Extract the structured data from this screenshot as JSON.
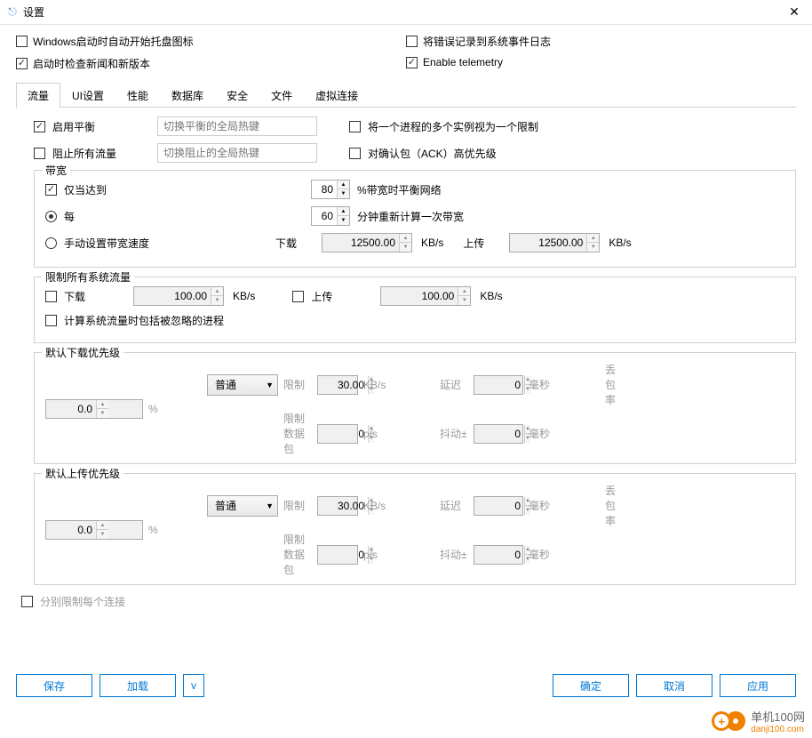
{
  "window": {
    "title": "设置"
  },
  "topOptions": {
    "left": [
      {
        "label": "Windows启动时自动开始托盘图标",
        "checked": false
      },
      {
        "label": "启动时检查新闻和新版本",
        "checked": true
      }
    ],
    "right": [
      {
        "label": "将错误记录到系统事件日志",
        "checked": false
      },
      {
        "label": "Enable telemetry",
        "checked": true
      }
    ]
  },
  "tabs": [
    "流量",
    "UI设置",
    "性能",
    "数据库",
    "安全",
    "文件",
    "虚拟连接"
  ],
  "activeTab": "流量",
  "traffic": {
    "enableBalance": {
      "label": "启用平衡",
      "checked": true,
      "hotkeyPlaceholder": "切换平衡的全局热键"
    },
    "blockAll": {
      "label": "阻止所有流量",
      "checked": false,
      "hotkeyPlaceholder": "切换阻止的全局热键"
    },
    "multiInstance": {
      "label": "将一个进程的多个实例视为一个限制",
      "checked": false
    },
    "ackPriority": {
      "label": "对确认包（ACK）高优先级",
      "checked": false
    }
  },
  "bandwidth": {
    "legend": "带宽",
    "onlyWhen": {
      "label": "仅当达到",
      "checked": true,
      "value": "80",
      "suffix": "%带宽时平衡网络"
    },
    "every": {
      "label": "每",
      "selected": true,
      "value": "60",
      "suffix": "分钟重新计算一次带宽"
    },
    "manual": {
      "label": "手动设置带宽速度",
      "selected": false
    },
    "download": {
      "label": "下载",
      "value": "12500.00",
      "unit": "KB/s"
    },
    "upload": {
      "label": "上传",
      "value": "12500.00",
      "unit": "KB/s"
    }
  },
  "limitAll": {
    "legend": "限制所有系统流量",
    "download": {
      "label": "下载",
      "checked": false,
      "value": "100.00",
      "unit": "KB/s"
    },
    "upload": {
      "label": "上传",
      "checked": false,
      "value": "100.00",
      "unit": "KB/s"
    },
    "includeIgnored": {
      "label": "计算系统流量时包括被忽略的进程",
      "checked": false
    }
  },
  "priorityLabels": {
    "limit": "限制",
    "unitKBs": "KB/s",
    "delay": "延迟",
    "ms": "毫秒",
    "dropRate": "丢包率",
    "pct": "%",
    "limitPkt": "限制数据包",
    "ps": "p/s",
    "jitter": "抖动±"
  },
  "dlPriority": {
    "legend": "默认下载优先级",
    "level": "普通",
    "limit": "30.00",
    "delay": "0",
    "drop": "0.0",
    "limitPkt": "0",
    "jitter": "0"
  },
  "ulPriority": {
    "legend": "默认上传优先级",
    "level": "普通",
    "limit": "30.00",
    "delay": "0",
    "drop": "0.0",
    "limitPkt": "0",
    "jitter": "0"
  },
  "perConnection": {
    "label": "分别限制每个连接",
    "checked": false
  },
  "buttons": {
    "save": "保存",
    "load": "加载",
    "dropdown": "v",
    "ok": "确定",
    "cancel": "取消",
    "apply": "应用"
  },
  "watermark": {
    "text": "单机100网",
    "sub": "danji100.com"
  }
}
